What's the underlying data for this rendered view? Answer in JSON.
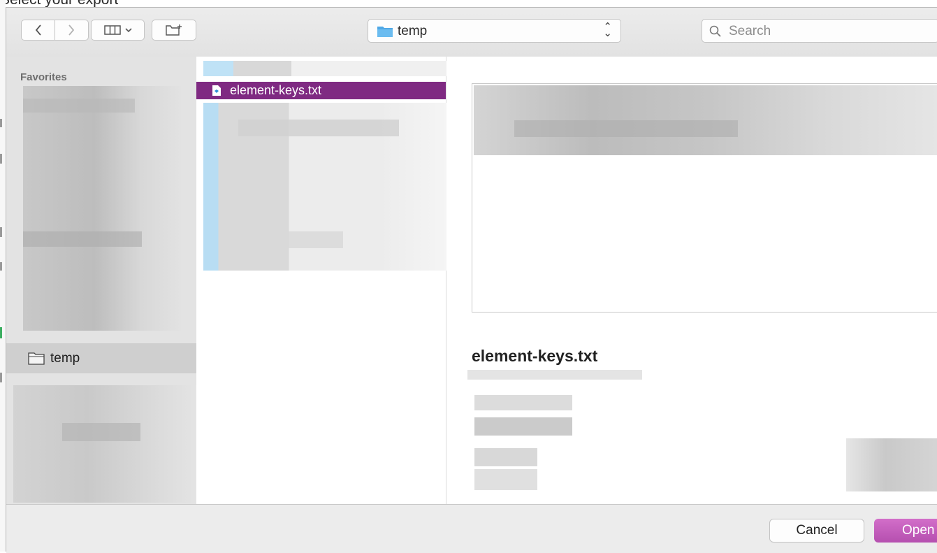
{
  "background": {
    "caption": "Select your export"
  },
  "toolbar": {
    "back_icon": "chevron-left-icon",
    "forward_icon": "chevron-right-icon",
    "view_icon": "column-view-icon",
    "new_folder_icon": "new-folder-icon",
    "location": "temp",
    "search_placeholder": "Search"
  },
  "sidebar": {
    "heading": "Favorites",
    "selected_item": "temp"
  },
  "browser": {
    "selected_file": "element-keys.txt"
  },
  "preview": {
    "file_name": "element-keys.txt"
  },
  "footer": {
    "cancel_label": "Cancel",
    "open_label": "Open"
  },
  "colors": {
    "selection": "#7f2a82",
    "primary_button": "#c25cbb",
    "folder": "#4fa8e6"
  }
}
